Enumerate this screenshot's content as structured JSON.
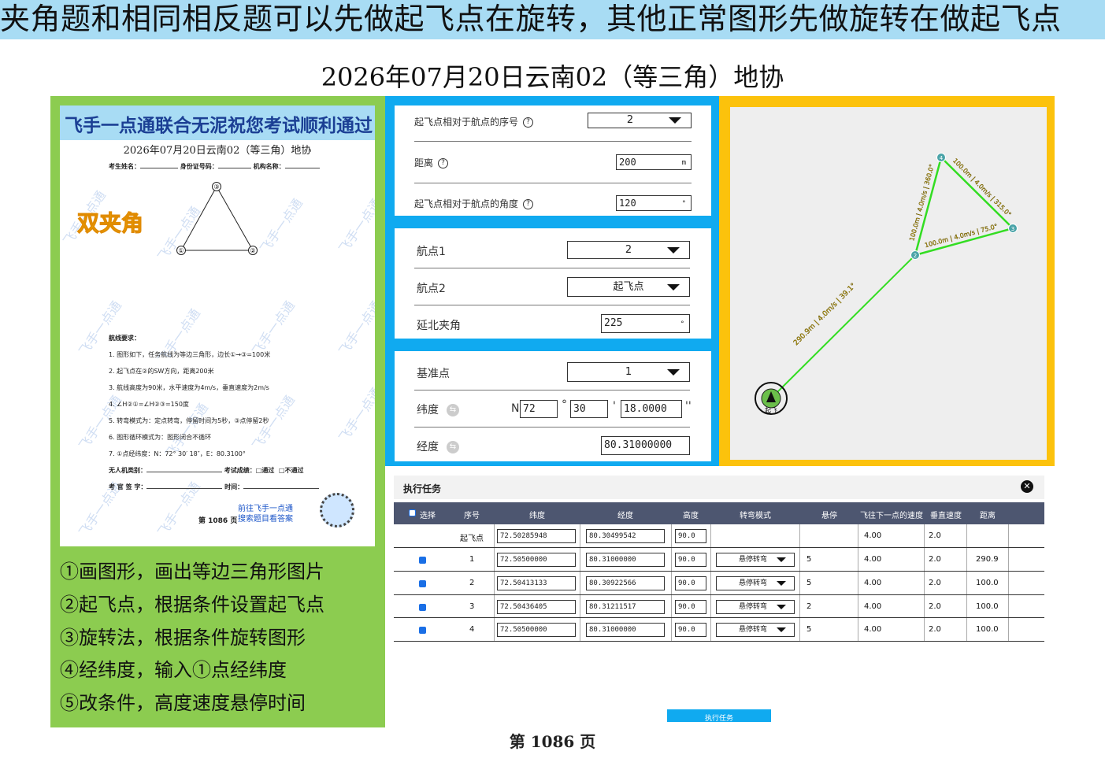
{
  "banner": "夹角题和相同相反题可以先做起飞点在旋转，其他正常图形先做旋转在做起飞点",
  "main_title": "2026年07月20日云南02（等三角）地协",
  "paper": {
    "banner": "飞手一点通联合无泥祝您考试顺利通过",
    "title": "2026年07月20日云南02（等三角）地协",
    "examinee_label": "考生姓名：",
    "id_label": "身份证号码：",
    "org_label": "机构名称：",
    "tag": "双夹角",
    "watermark": "飞手一点通",
    "points": [
      "①",
      "②",
      "③"
    ],
    "req_title": "航线要求：",
    "requirements": [
      "1.  图形如下，任务航线为等边三角形，边长①→③=100米",
      "2.  起飞点在②的SW方向，距离200米",
      "3.  航线高度为90米，水平速度为4m/s，垂直速度为2m/s",
      "4.  ∠H②①=∠H②③=150度",
      "5.  转弯模式为：定点转弯，停留时间为5秒，③点停留2秒",
      "6.  图形循环模式为：图形闭合不循环",
      "7.  ①点经纬度：N：72° 30′ 18″，E：80.3100°"
    ],
    "uav_label": "无人机类别：",
    "result_label": "考试成绩：",
    "pass": "□通过",
    "fail": "□不通过",
    "examiner_label": "考 官 签 字：",
    "time_label": "时间：",
    "page": "第  1086  页",
    "link1": "前往飞手一点通",
    "link2": "搜索题目看答案"
  },
  "steps": [
    "①画图形，画出等边三角形图片",
    "②起飞点，根据条件设置起飞点",
    "③旋转法，根据条件旋转图形",
    "④经纬度，输入①点经纬度",
    "⑤改条件，高度速度悬停时间"
  ],
  "takeoff_settings": {
    "seq_label": "起飞点相对于航点的序号",
    "seq_value": "2",
    "dist_label": "距离",
    "dist_value": "200",
    "dist_unit": "m",
    "angle_label": "起飞点相对于航点的角度",
    "angle_value": "120",
    "angle_unit": "°",
    "help": "?"
  },
  "rotation": {
    "wp1_label": "航点1",
    "wp1_value": "2",
    "wp2_label": "航点2",
    "wp2_value": "起飞点",
    "angle_label": "延北夹角",
    "angle_value": "225",
    "angle_unit": "°"
  },
  "coords": {
    "base_label": "基准点",
    "base_value": "1",
    "lat_label": "纬度",
    "lat_prefix": "N",
    "lat_deg": "72",
    "lat_min": "30",
    "lat_sec": "18.0000",
    "deg_sym": "°",
    "min_sym": "'",
    "sec_sym": "''",
    "lon_label": "经度",
    "lon_value": "80.31000000",
    "swap_icon": "⇆"
  },
  "map": {
    "takeoff_label": "起飞",
    "seg_takeoff": "290.9m | 4.0m/s | 39.1°",
    "seg_2_4": "100.0m | 4.0m/s | 360.0°",
    "seg_4_3": "100.0m | 4.0m/s | 315.0°",
    "seg_3_2": "100.0m | 4.0m/s | 75.0°",
    "wp_labels": [
      "2",
      "3",
      "4"
    ]
  },
  "task": {
    "title": "执行任务",
    "close": "✕",
    "headers": [
      "选择",
      "序号",
      "纬度",
      "经度",
      "高度",
      "转弯模式",
      "悬停",
      "飞往下一点的速度",
      "垂直速度",
      "距离"
    ],
    "rows": [
      {
        "seq": "起飞点",
        "lat": "72.50285948",
        "lon": "80.30499542",
        "alt": "90.0",
        "turn": "",
        "hover": "",
        "speed": "4.00",
        "vspeed": "2.0",
        "dist": ""
      },
      {
        "seq": "1",
        "lat": "72.50500000",
        "lon": "80.31000000",
        "alt": "90.0",
        "turn": "悬停转弯",
        "hover": "5",
        "speed": "4.00",
        "vspeed": "2.0",
        "dist": "290.9"
      },
      {
        "seq": "2",
        "lat": "72.50413133",
        "lon": "80.30922566",
        "alt": "90.0",
        "turn": "悬停转弯",
        "hover": "5",
        "speed": "4.00",
        "vspeed": "2.0",
        "dist": "100.0"
      },
      {
        "seq": "3",
        "lat": "72.50436405",
        "lon": "80.31211517",
        "alt": "90.0",
        "turn": "悬停转弯",
        "hover": "2",
        "speed": "4.00",
        "vspeed": "2.0",
        "dist": "100.0"
      },
      {
        "seq": "4",
        "lat": "72.50500000",
        "lon": "80.31000000",
        "alt": "90.0",
        "turn": "悬停转弯",
        "hover": "5",
        "speed": "4.00",
        "vspeed": "2.0",
        "dist": "100.0"
      }
    ]
  },
  "exec_button": "执行任务",
  "page_number": "第  1086  页",
  "colors": {
    "banner_bg": "#a8dcf4",
    "green_panel": "#8ccc50",
    "blue_panel": "#10aaf0",
    "yellow_panel": "#fcc20c",
    "route_line": "#33dd22",
    "table_header": "#4d5670"
  }
}
